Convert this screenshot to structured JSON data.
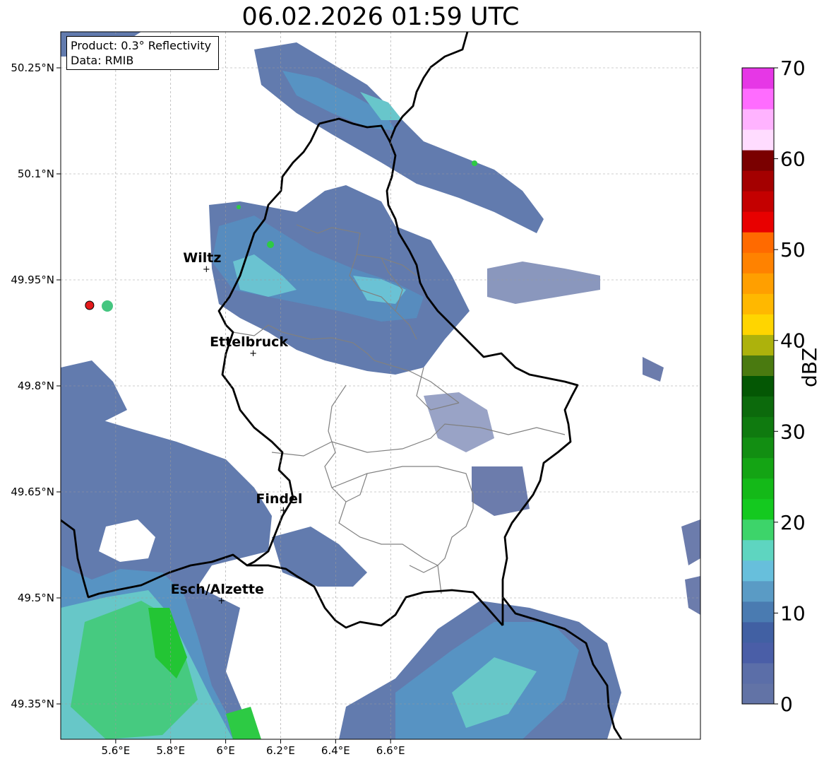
{
  "title": "06.02.2026 01:59 UTC",
  "info": {
    "product": "Product: 0.3° Reflectivity",
    "data": "Data: RMIB"
  },
  "map": {
    "x_ticks": [
      {
        "value": 5.6,
        "label": "5.6°E"
      },
      {
        "value": 5.8,
        "label": "5.8°E"
      },
      {
        "value": 6.0,
        "label": "6°E"
      },
      {
        "value": 6.2,
        "label": "6.2°E"
      },
      {
        "value": 6.4,
        "label": "6.4°E"
      },
      {
        "value": 6.6,
        "label": "6.6°E"
      }
    ],
    "y_ticks": [
      {
        "value": 50.25,
        "label": "50.25°N"
      },
      {
        "value": 50.1,
        "label": "50.1°N"
      },
      {
        "value": 49.95,
        "label": "49.95°N"
      },
      {
        "value": 49.8,
        "label": "49.8°N"
      },
      {
        "value": 49.65,
        "label": "49.65°N"
      },
      {
        "value": 49.5,
        "label": "49.5°N"
      },
      {
        "value": 49.35,
        "label": "49.35°N"
      }
    ],
    "cities": [
      {
        "name": "Wiltz",
        "lon": 5.93,
        "lat": 49.966
      },
      {
        "name": "Ettelbruck",
        "lon": 6.1,
        "lat": 49.847
      },
      {
        "name": "Findel",
        "lon": 6.21,
        "lat": 49.625
      },
      {
        "name": "Esch/Alzette",
        "lon": 5.985,
        "lat": 49.497
      }
    ],
    "radar_site": {
      "lon": 5.505,
      "lat": 49.914,
      "color": "#e41a1c"
    },
    "grid": true
  },
  "colorbar": {
    "label": "dBZ",
    "ticks": [
      "0",
      "10",
      "20",
      "30",
      "40",
      "50",
      "60",
      "70"
    ],
    "colors": [
      "#6273a6",
      "#5b6ea8",
      "#4a5ea7",
      "#4160a3",
      "#4a7bb1",
      "#5a9bc5",
      "#67bfdc",
      "#5ed5c0",
      "#3dd46a",
      "#14c91f",
      "#14b918",
      "#14a414",
      "#128e12",
      "#0f7a0f",
      "#0c6a0c",
      "#045704",
      "#4a7a10",
      "#adb20c",
      "#ffd500",
      "#ffb800",
      "#ff9f00",
      "#ff8200",
      "#ff6a00",
      "#e80000",
      "#c40000",
      "#a40000",
      "#7a0000",
      "#ffdcff",
      "#ffb3ff",
      "#ff6cff",
      "#e637e6"
    ]
  }
}
